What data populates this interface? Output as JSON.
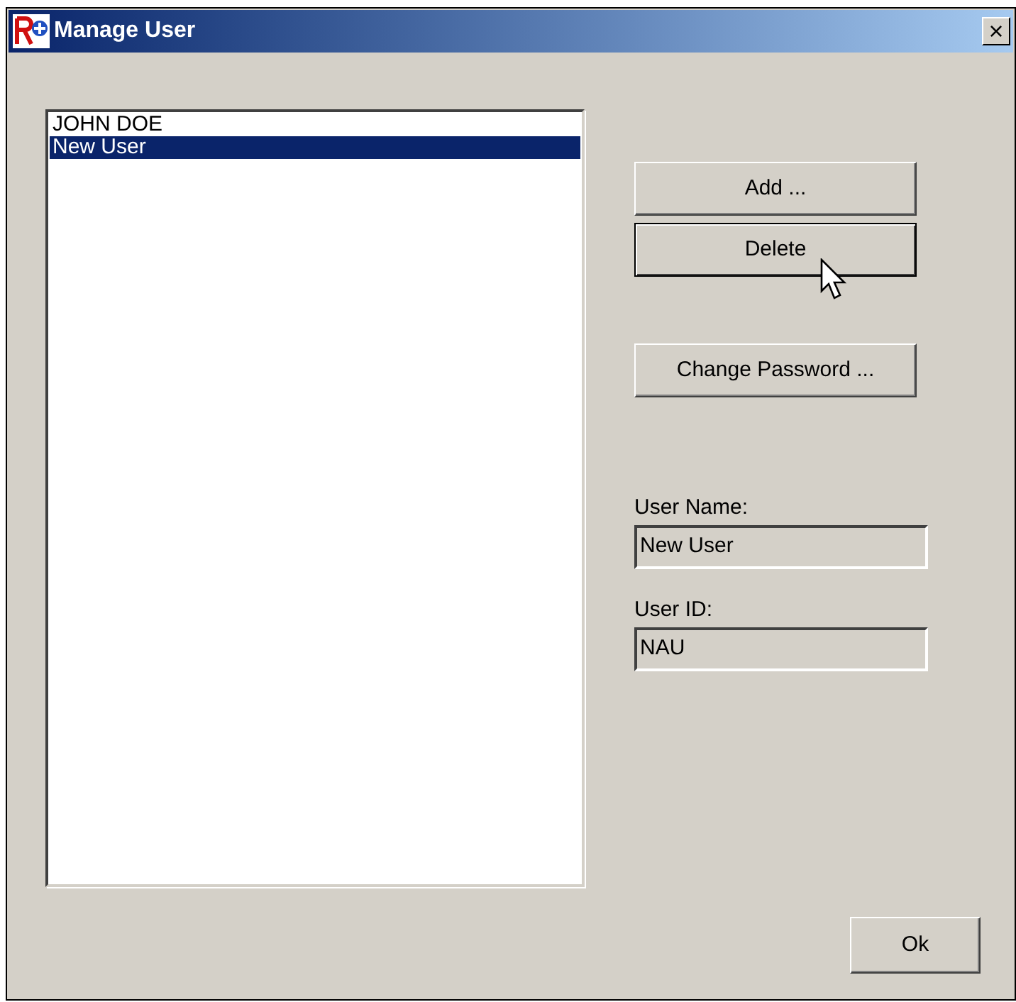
{
  "window": {
    "title": "Manage User",
    "close": "×"
  },
  "users": [
    {
      "name": "JOHN DOE",
      "selected": false
    },
    {
      "name": "New User",
      "selected": true
    }
  ],
  "buttons": [
    {
      "label": "Add ...",
      "focused": false
    },
    {
      "label": "Delete",
      "focused": true
    },
    {
      "label": "Change Password ...",
      "focused": false
    }
  ],
  "fields": [
    {
      "label": "User Name:",
      "value": "New User",
      "disabled": true
    },
    {
      "label": "User ID:",
      "value": "NAU",
      "disabled": true
    }
  ],
  "ok_button": {
    "label": "Ok"
  }
}
